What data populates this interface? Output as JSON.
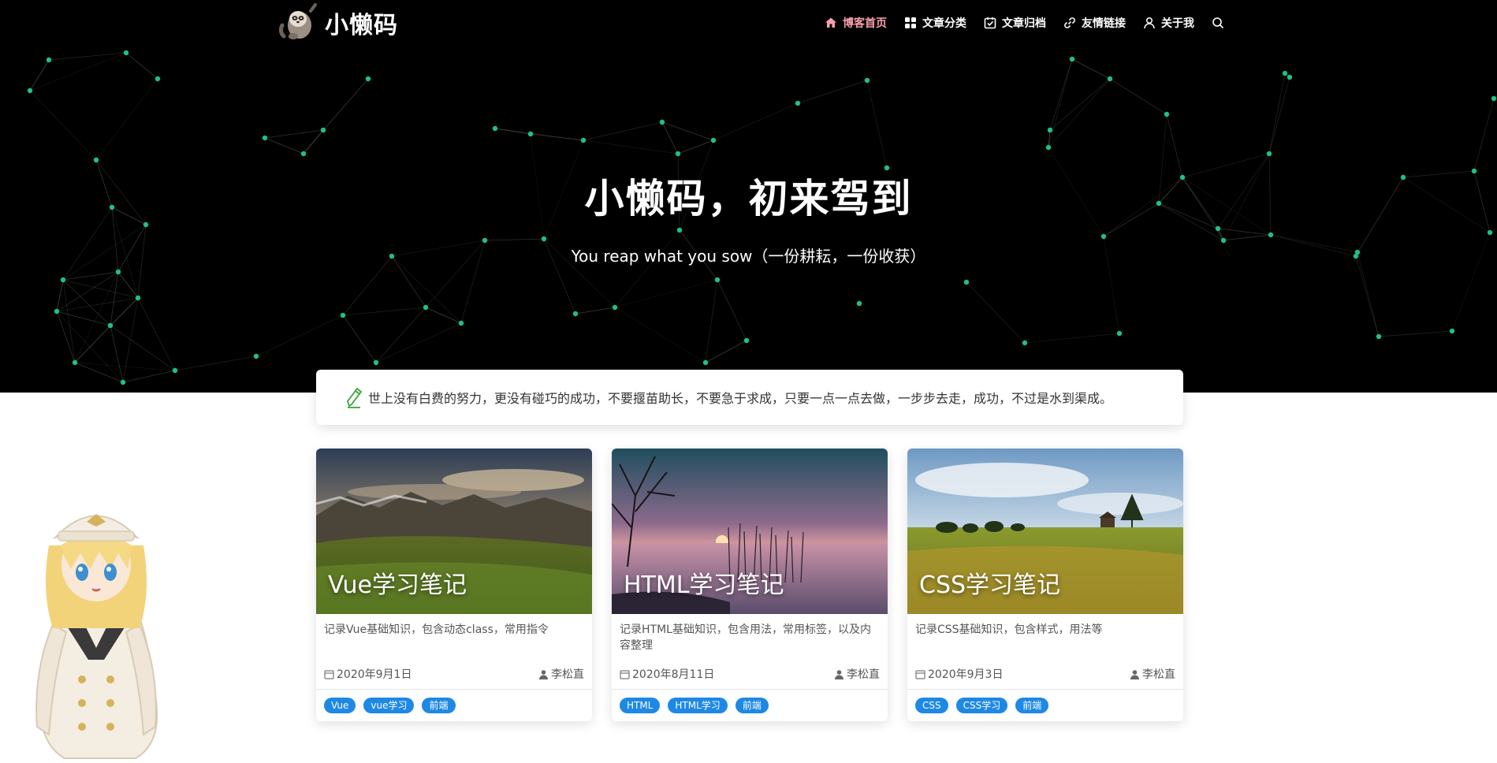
{
  "site": {
    "logo_text": "小懒码"
  },
  "nav": {
    "items": [
      {
        "label": "博客首页",
        "icon": "home-icon",
        "active": true
      },
      {
        "label": "文章分类",
        "icon": "grid-icon",
        "active": false
      },
      {
        "label": "文章归档",
        "icon": "calendar-check-icon",
        "active": false
      },
      {
        "label": "友情链接",
        "icon": "link-icon",
        "active": false
      },
      {
        "label": "关于我",
        "icon": "user-icon",
        "active": false
      }
    ],
    "search_icon": "search-icon",
    "active_color": "#f5a0ab"
  },
  "hero": {
    "title": "小懒码，初来驾到",
    "subtitle": "You reap what you sow（一份耕耘，一份收获）",
    "background": "#000000",
    "node_color": "#1fbf8f"
  },
  "quote": {
    "icon": "pencil-icon",
    "text": "世上没有白费的努力，更没有碰巧的成功，不要揠苗助长，不要急于求成，只要一点一点去做，一步步去走，成功，不过是水到渠成。"
  },
  "cards": [
    {
      "title": "Vue学习笔记",
      "description": "记录Vue基础知识，包含动态class，常用指令",
      "date": "2020年9月1日",
      "author": "李松直",
      "tags": [
        "Vue",
        "vue学习",
        "前端"
      ]
    },
    {
      "title": "HTML学习笔记",
      "description": "记录HTML基础知识，包含用法，常用标签，以及内容整理",
      "date": "2020年8月11日",
      "author": "李松直",
      "tags": [
        "HTML",
        "HTML学习",
        "前端"
      ]
    },
    {
      "title": "CSS学习笔记",
      "description": "记录CSS基础知识，包含样式，用法等",
      "date": "2020年9月3日",
      "author": "李松直",
      "tags": [
        "CSS",
        "CSS学习",
        "前端"
      ]
    }
  ],
  "tag_color": "#1e88e5"
}
